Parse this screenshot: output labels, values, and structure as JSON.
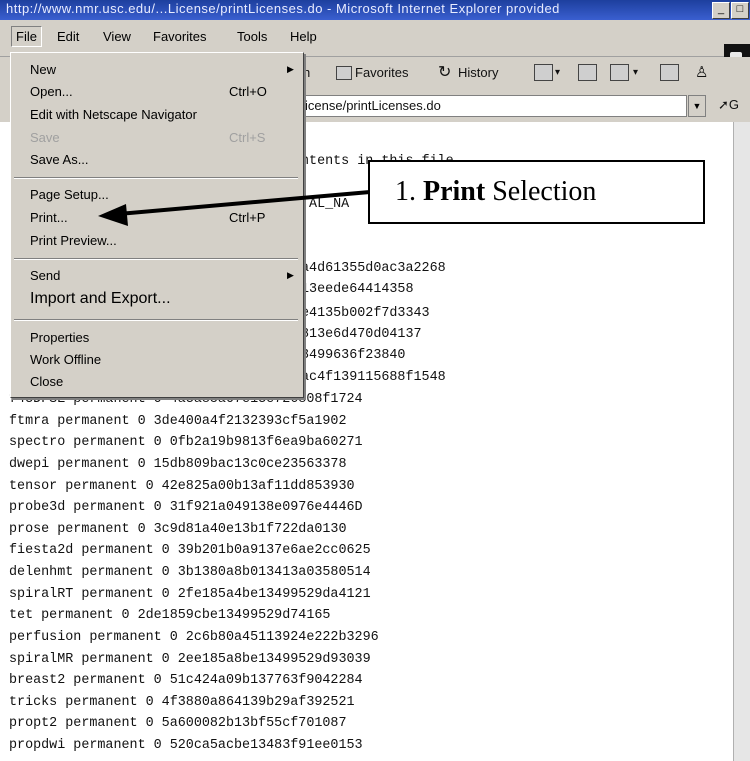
{
  "window": {
    "title": "http://www.nmr.usc.edu/...License/printLicenses.do - Microsoft Internet Explorer provided"
  },
  "menubar": [
    "File",
    "Edit",
    "View",
    "Favorites",
    "Tools",
    "Help"
  ],
  "toolbar": {
    "search_label": "h",
    "favorites_label": "Favorites",
    "history_label": "History"
  },
  "address": {
    "value": "icense/printLicenses.do",
    "go_label": "G"
  },
  "file_menu": [
    {
      "label": "New",
      "shortcut": ""
    },
    {
      "label": "Open...",
      "shortcut": "Ctrl+O"
    },
    {
      "label": "Edit with Netscape Navigator",
      "shortcut": ""
    },
    {
      "label": "Save",
      "shortcut": "Ctrl+S"
    },
    {
      "label": "Save As...",
      "shortcut": ""
    },
    {
      "label": "Page Setup...",
      "shortcut": ""
    },
    {
      "label": "Print...",
      "shortcut": "Ctrl+P"
    },
    {
      "label": "Print Preview...",
      "shortcut": ""
    },
    {
      "label": "Send",
      "shortcut": ""
    },
    {
      "label": "Import and Export...",
      "shortcut": ""
    },
    {
      "label": "Properties",
      "shortcut": ""
    },
    {
      "label": "Work Offline",
      "shortcut": ""
    },
    {
      "label": "Close",
      "shortcut": ""
    }
  ],
  "callout": {
    "number": "1.",
    "bold": "Print",
    "rest": "Selection"
  },
  "content_partial": [
    "ntents in this file",
    "TAL_NA",
    "a4d61355d0ac3a2268",
    "13eede64414358",
    "e4135b002f7d3343",
    "813e6d470d04137",
    "3499636f23840",
    "ac4f139115688f1548"
  ],
  "content_lines": [
    "f43DFSE permanent 0 4a3a85a07e13e726808f1724",
    "ftmra permanent 0 3de400a4f2132393cf5a1902",
    "spectro permanent 0 0fb2a19b9813f6ea9ba60271",
    "dwepi permanent 0 15db809bac13c0ce23563378",
    "tensor permanent 0 42e825a00b13af11dd853930",
    "probe3d permanent 0 31f921a049138e0976e4446D",
    "prose permanent 0 3c9d81a40e13b1f722da0130",
    "fiesta2d permanent 0 39b201b0a9137e6ae2cc0625",
    "delenhmt permanent 0 3b1380a8b013413a03580514",
    "spiralRT permanent 0 2fe185a4be13499529da4121",
    "tet permanent 0 2de1859cbe13499529d74165",
    "perfusion permanent 0 2c6b80a45113924e222b3296",
    "spiralMR permanent 0 2ee185a8be13499529d93039",
    "breast2 permanent 0 51c424a09b137763f9042284",
    "tricks permanent 0 4f3880a864139b29af392521",
    "propt2 permanent 0 5a600082b13bf55cf701087",
    "propdwi permanent 0 520ca5acbe13483f91ee0153"
  ]
}
